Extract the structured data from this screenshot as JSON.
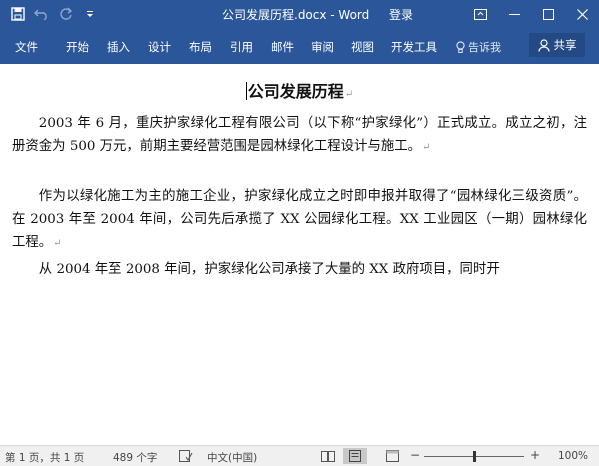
{
  "window": {
    "title": "公司发展历程.docx - Word",
    "signin_label": "登录"
  },
  "ribbon": {
    "tabs": [
      "文件",
      "开始",
      "插入",
      "设计",
      "布局",
      "引用",
      "邮件",
      "审阅",
      "视图",
      "开发工具"
    ],
    "tell_me": "告诉我",
    "share_label": "共享"
  },
  "document": {
    "title": "公司发展历程",
    "paragraphs": [
      "2003 年 6 月，重庆护家绿化工程有限公司（以下称“护家绿化”）正式成立。成立之初，注册资金为 500 万元，前期主要经营范围是园林绿化工程设计与施工。",
      "作为以绿化施工为主的施工企业，护家绿化成立之时即申报并取得了“园林绿化三级资质”。在 2003 年至 2004 年间，公司先后承揽了 XX 公园绿化工程。XX 工业园区（一期）园林绿化工程。",
      "从 2004 年至 2008 年间，护家绿化公司承接了大量的 XX 政府项目，同时开"
    ]
  },
  "status": {
    "page": "第 1 页，共 1 页",
    "words": "489 个字",
    "language": "中文(中国)",
    "zoom_percent": 100,
    "zoom_label": "100%"
  },
  "icons": {
    "save": "save-icon",
    "undo": "undo-icon",
    "redo": "redo-icon",
    "customize": "customize-qat-icon",
    "ribbon_display": "ribbon-display-options-icon",
    "minimize": "minimize-icon",
    "restore": "restore-icon",
    "close": "close-icon",
    "lightbulb": "lightbulb-icon",
    "share": "person-icon"
  },
  "colors": {
    "ribbon_blue": "#2b579a",
    "status_gray": "#f0f0f0"
  }
}
